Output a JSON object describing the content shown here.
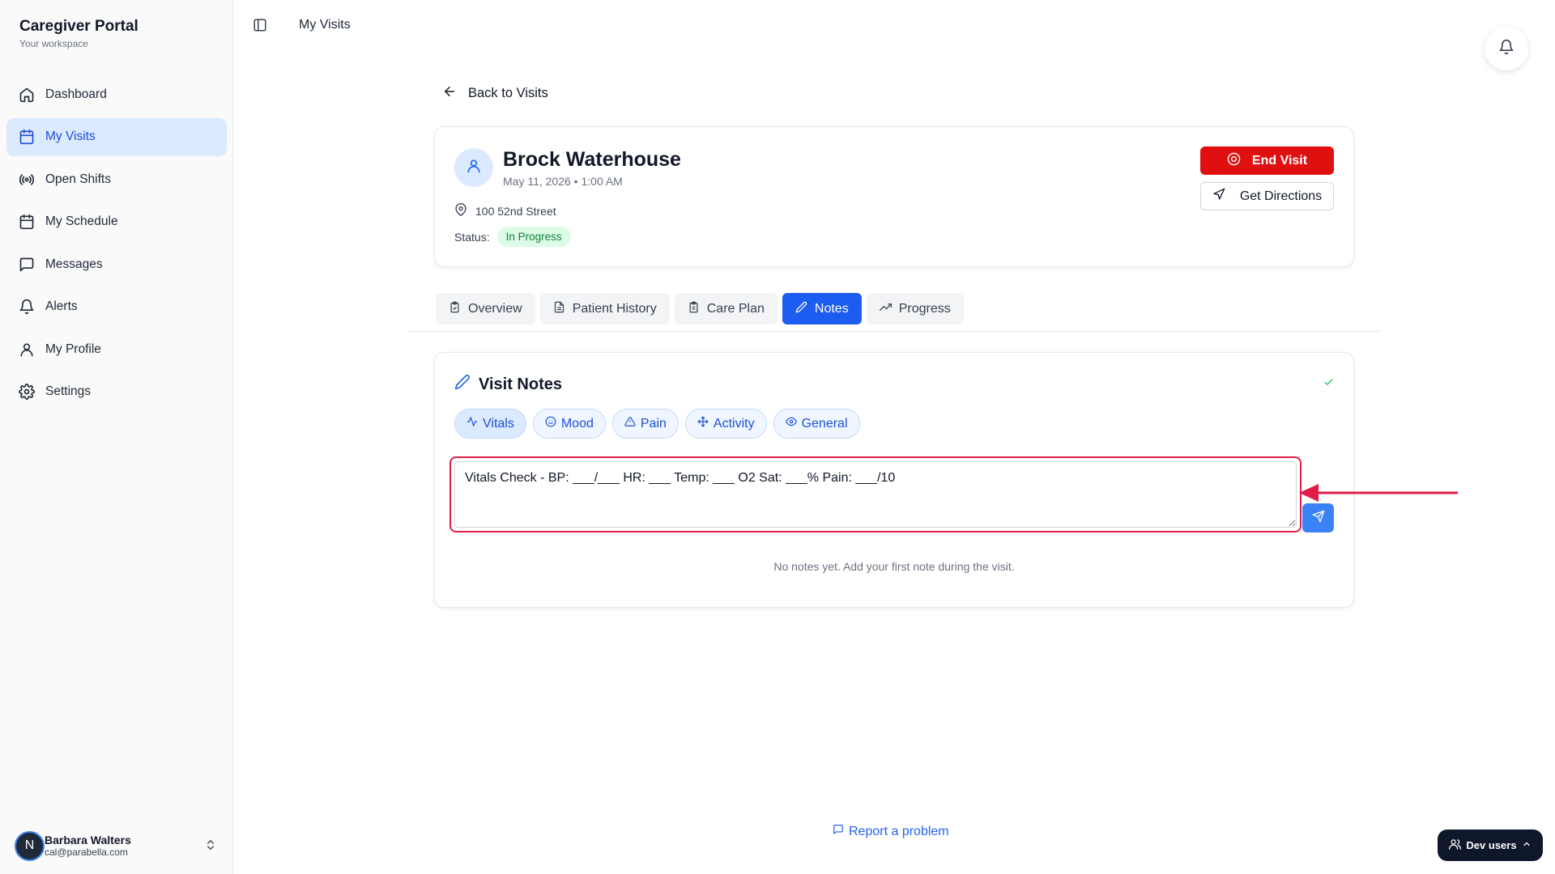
{
  "sidebar": {
    "brand_title": "Caregiver Portal",
    "brand_subtitle": "Your workspace",
    "items": [
      {
        "label": "Dashboard",
        "icon": "home-icon"
      },
      {
        "label": "My Visits",
        "icon": "calendar-icon",
        "active": true
      },
      {
        "label": "Open Shifts",
        "icon": "broadcast-icon"
      },
      {
        "label": "My Schedule",
        "icon": "calendar-icon"
      },
      {
        "label": "Messages",
        "icon": "message-icon"
      },
      {
        "label": "Alerts",
        "icon": "bell-icon"
      },
      {
        "label": "My Profile",
        "icon": "user-icon"
      },
      {
        "label": "Settings",
        "icon": "gear-icon"
      }
    ],
    "user": {
      "initial": "N",
      "name": "Barbara Walters",
      "email": "cal@parabella.com"
    }
  },
  "topbar": {
    "title": "My Visits"
  },
  "main": {
    "back_label": "Back to Visits",
    "patient": {
      "name": "Brock Waterhouse",
      "datetime": "May 11, 2026 • 1:00 AM",
      "address": "100 52nd Street",
      "status_label": "Status:",
      "status_value": "In Progress"
    },
    "actions": {
      "end_visit": "End Visit",
      "get_directions": "Get Directions"
    },
    "tabs": [
      {
        "label": "Overview"
      },
      {
        "label": "Patient History"
      },
      {
        "label": "Care Plan"
      },
      {
        "label": "Notes",
        "active": true
      },
      {
        "label": "Progress"
      }
    ],
    "notes": {
      "title": "Visit Notes",
      "chips": [
        "Vitals",
        "Mood",
        "Pain",
        "Activity",
        "General"
      ],
      "textarea_value": "Vitals Check - BP: ___/___ HR: ___ Temp: ___ O2 Sat: ___% Pain: ___/10",
      "empty_message": "No notes yet. Add your first note during the visit."
    },
    "report_label": "Report a problem"
  },
  "dev_users_label": "Dev users",
  "colors": {
    "accent": "#1d5cf0",
    "danger": "#e01010",
    "success": "#15803d",
    "annotation": "#e11d48"
  }
}
